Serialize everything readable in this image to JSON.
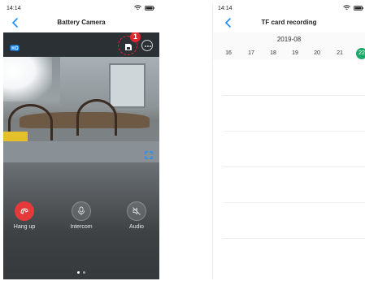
{
  "left_screen": {
    "status_time": "14:14",
    "title": "Battery Camera",
    "step_number": "1",
    "controls": [
      {
        "label": "Hang up"
      },
      {
        "label": "Intercom"
      },
      {
        "label": "Audio"
      }
    ],
    "icons": {
      "back": "chevron-left-icon",
      "hd": "hd-icon",
      "record": "tf-card-record-icon",
      "more": "more-options-icon",
      "fullscreen": "fullscreen-icon",
      "hangup": "hang-up-phone-icon",
      "intercom": "microphone-icon",
      "audio": "speaker-muted-icon"
    },
    "colors": {
      "accent": "#1a8cff",
      "hangup": "#e53a3a",
      "highlight": "#e0282e"
    }
  },
  "right_screen": {
    "status_time": "14:14",
    "title": "TF card recording",
    "month": "2019-08",
    "days": [
      "16",
      "17",
      "18",
      "19",
      "20",
      "21",
      "22"
    ],
    "selected_day": "22",
    "colors": {
      "selected_day": "#1ea86a"
    }
  }
}
